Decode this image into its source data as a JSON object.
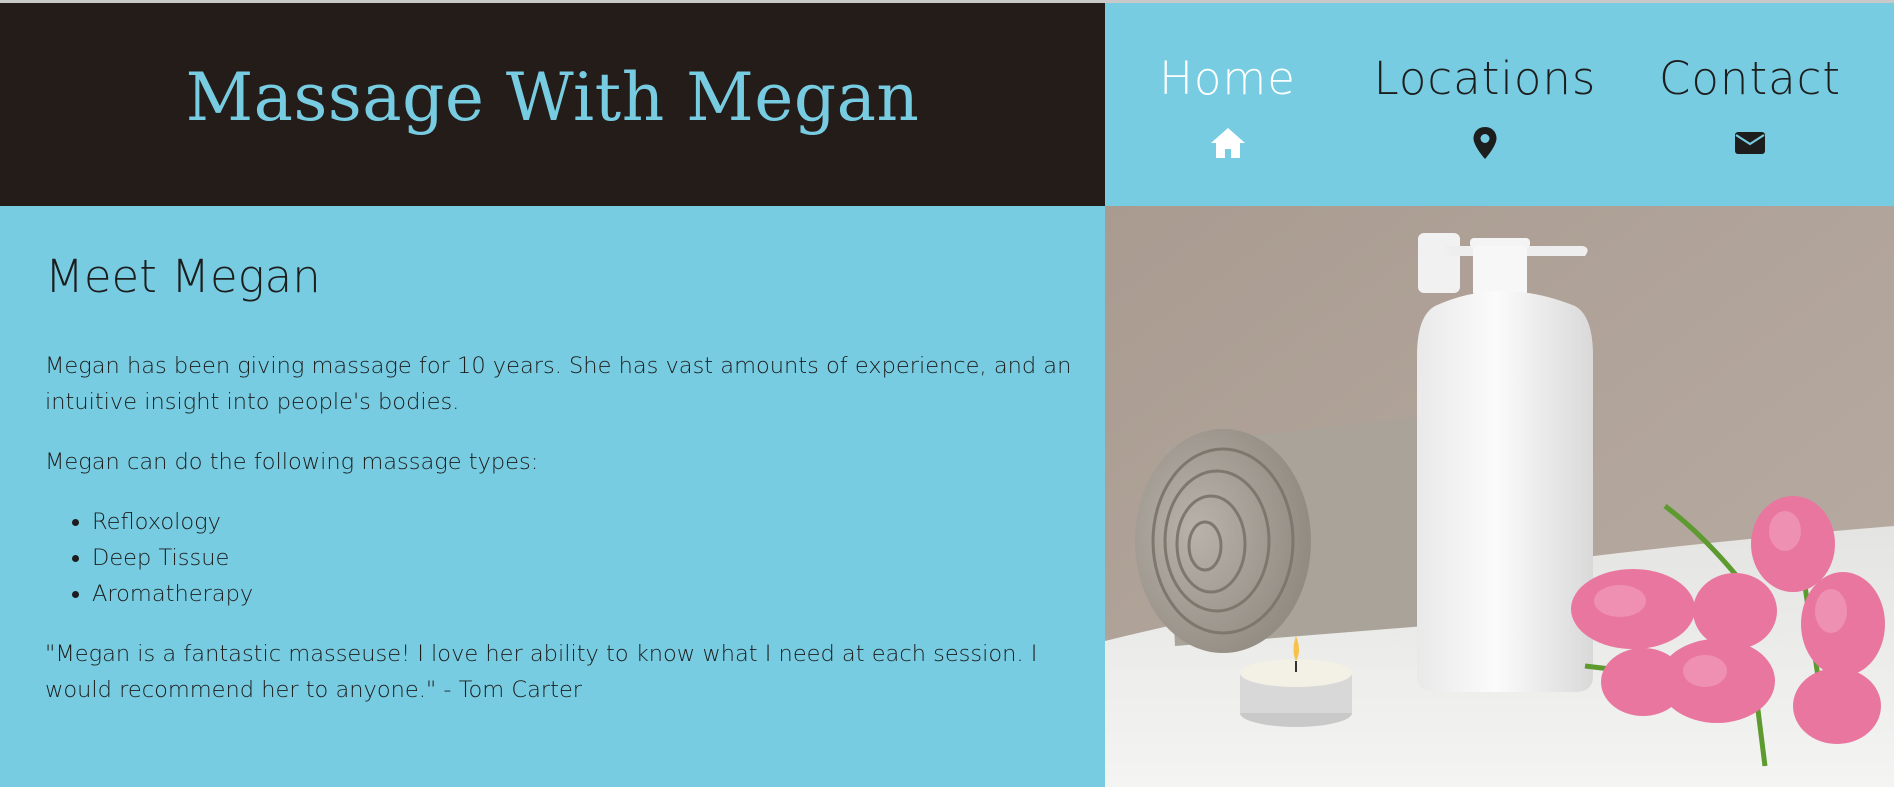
{
  "header": {
    "site_title": "Massage With Megan"
  },
  "nav": {
    "items": [
      {
        "label": "Home",
        "icon": "home-icon"
      },
      {
        "label": "Locations",
        "icon": "map-marker-icon"
      },
      {
        "label": "Contact",
        "icon": "envelope-icon"
      }
    ]
  },
  "content": {
    "heading": "Meet Megan",
    "intro": "Megan has been giving massage for 10 years. She has vast amounts of experience, and an intuitive insight into people's bodies.",
    "types_intro": "Megan can do the following massage types:",
    "types": [
      "Refloxology",
      "Deep Tissue",
      "Aromatherapy"
    ],
    "testimonial": "\"Megan is a fantastic masseuse! I love her ability to know what I need at each session. I would recommend her to anyone.\" - Tom Carter"
  },
  "colors": {
    "accent": "#77cce1",
    "header_dark": "#231c18",
    "text": "#1d1d1d",
    "nav_active": "#ffffff"
  }
}
